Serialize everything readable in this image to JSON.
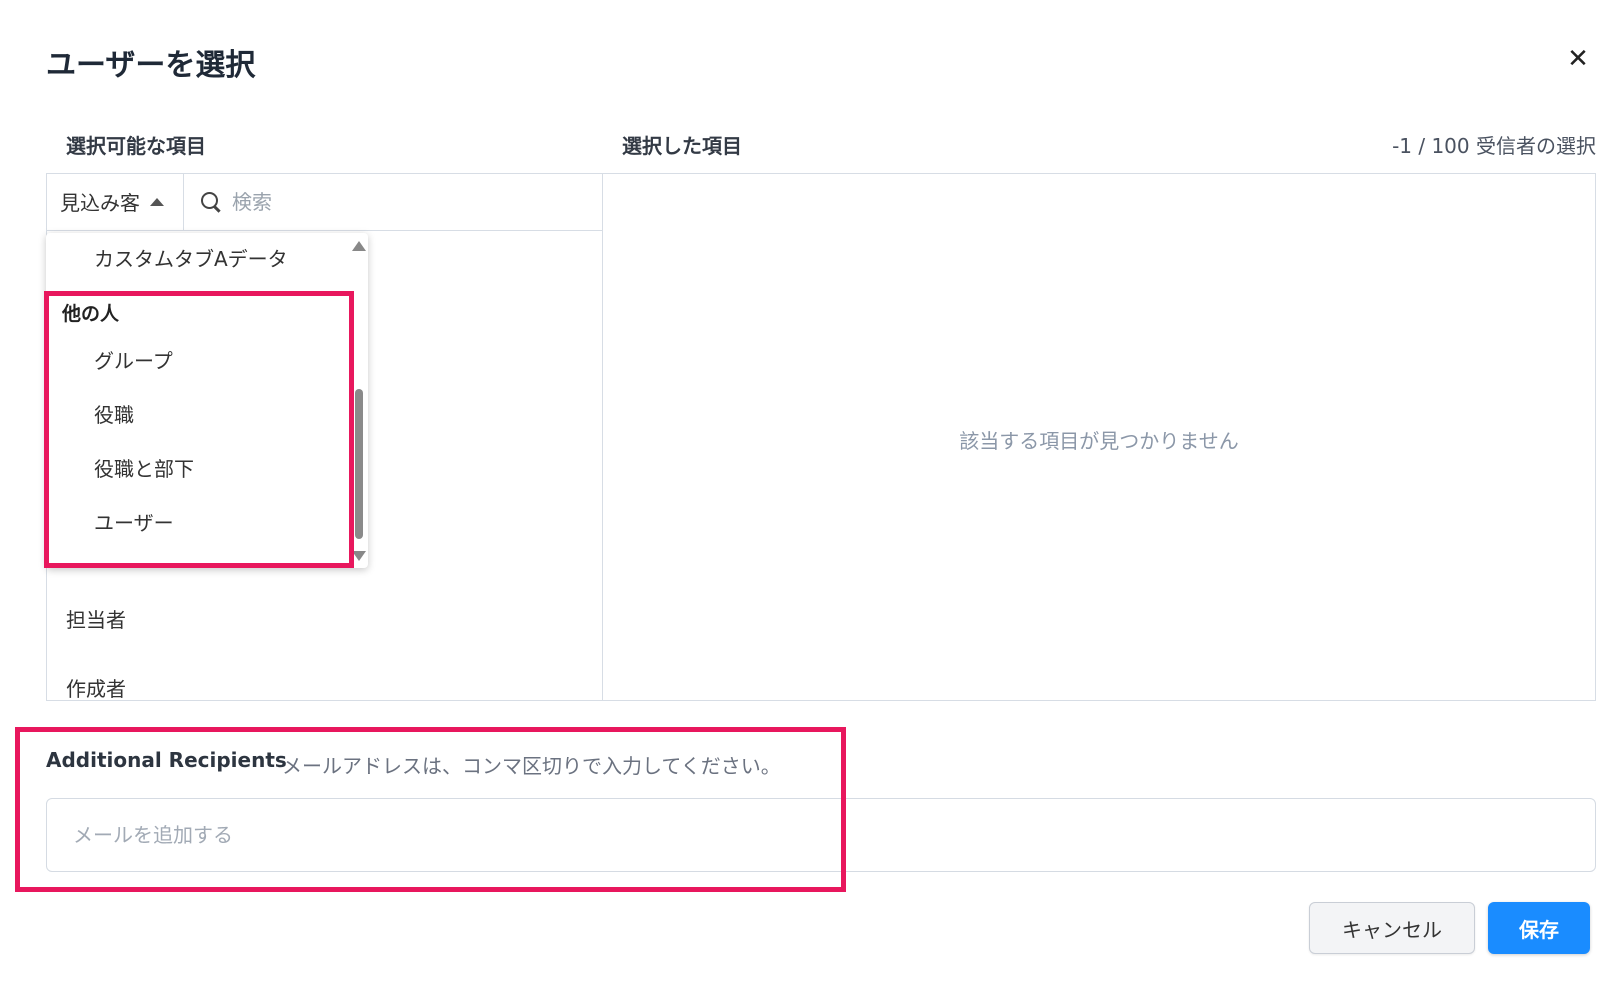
{
  "dialog": {
    "title": "ユーザーを選択",
    "close_icon": "close-icon"
  },
  "available": {
    "heading": "選択可能な項目",
    "type_select": {
      "value": "見込み客",
      "icon": "caret-up-icon"
    },
    "search": {
      "placeholder": "検索",
      "value": "",
      "icon": "search-icon"
    },
    "items": [
      "担当者",
      "作成者"
    ]
  },
  "dropdown": {
    "top_item": "カスタムタブAデータ",
    "group": {
      "label": "他の人",
      "items": [
        "グループ",
        "役職",
        "役職と部下",
        "ユーザー"
      ]
    }
  },
  "selected": {
    "heading": "選択した項目",
    "counter": "-1 / 100 受信者の選択",
    "empty_message": "該当する項目が見つかりません"
  },
  "recipients": {
    "label": "Additional Recipients",
    "hint": "メールアドレスは、コンマ区切りで入力してください。",
    "placeholder": "メールを追加する",
    "value": ""
  },
  "footer": {
    "cancel_label": "キャンセル",
    "save_label": "保存"
  },
  "colors": {
    "accent": "#1a8cff",
    "highlight": "#e8175d",
    "border": "#d7dde5",
    "muted_text": "#8b97a8"
  }
}
